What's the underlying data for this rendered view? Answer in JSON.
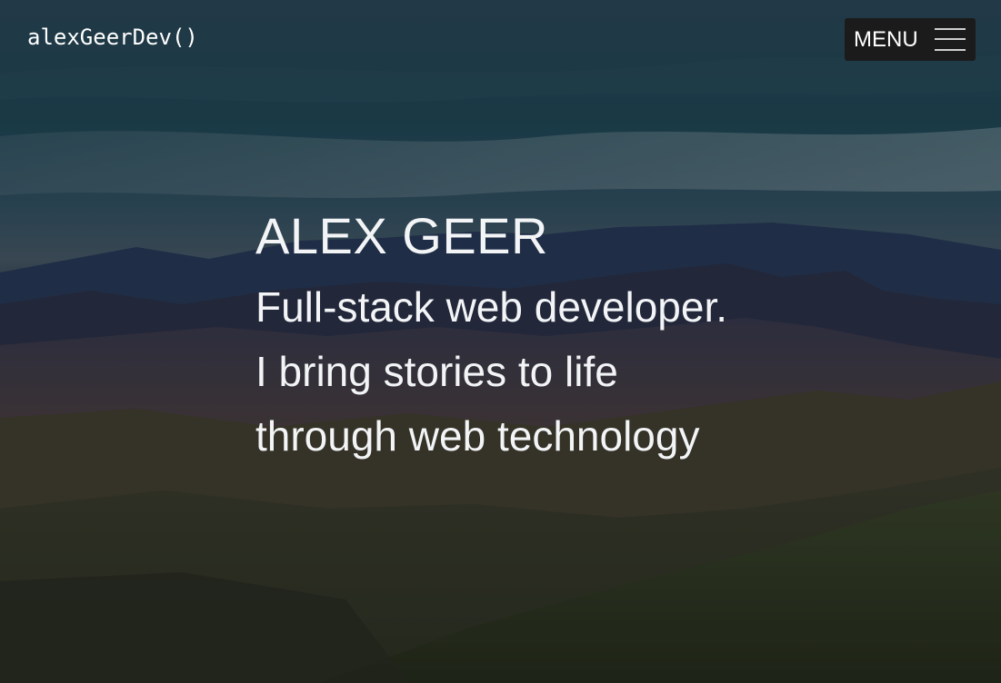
{
  "header": {
    "brand": "alexGeerDev()",
    "menu_label": "MENU",
    "menu_icon": "hamburger-icon"
  },
  "hero": {
    "name": "ALEX GEER",
    "tagline_lines": [
      "Full-stack web developer.",
      "I bring stories to life",
      "through web technology"
    ],
    "background": "mountain-landscape-image"
  },
  "colors": {
    "text": "#f2f4f6",
    "menu_bg": "#1b1b1b"
  }
}
